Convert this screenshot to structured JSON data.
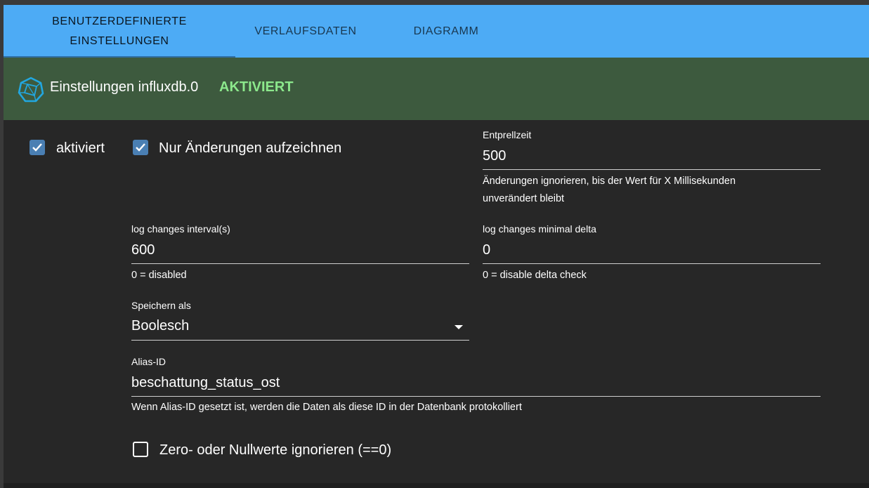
{
  "tabs": [
    {
      "label": "BENUTZERDEFINIERTE EINSTELLUNGEN",
      "line1": "BENUTZERDEFINIERTE",
      "line2": "EINSTELLUNGEN",
      "active": true
    },
    {
      "label": "VERLAUFSDATEN",
      "active": false
    },
    {
      "label": "DIAGRAMM",
      "active": false
    }
  ],
  "header": {
    "icon": "influxdb-logo-icon",
    "title": "Einstellungen influxdb.0",
    "status": "AKTIVIERT",
    "status_color": "#8ce88c",
    "background": "#3d5a3e"
  },
  "form": {
    "enabled": {
      "label": "aktiviert",
      "checked": true
    },
    "changes_only": {
      "label": "Nur Änderungen aufzeichnen",
      "checked": true
    },
    "debounce": {
      "label": "Entprellzeit",
      "value": "500",
      "helper_line1": "Änderungen ignorieren, bis der Wert für X Millisekunden",
      "helper_line2": "unverändert bleibt"
    },
    "log_interval": {
      "label": "log changes interval(s)",
      "value": "600",
      "helper": "0 = disabled"
    },
    "min_delta": {
      "label": "log changes minimal delta",
      "value": "0",
      "helper": "0 = disable delta check"
    },
    "store_as": {
      "label": "Speichern als",
      "value": "Boolesch"
    },
    "alias": {
      "label": "Alias-ID",
      "value": "beschattung_status_ost",
      "helper": "Wenn Alias-ID gesetzt ist, werden die Daten als diese ID in der Datenbank protokolliert"
    },
    "ignore_zero": {
      "label": "Zero- oder Nullwerte ignorieren (==0)",
      "checked": false
    }
  },
  "colors": {
    "tab_bar": "#4dabf5",
    "checkbox_accent": "#4a7fb3",
    "panel_background": "#272727"
  }
}
